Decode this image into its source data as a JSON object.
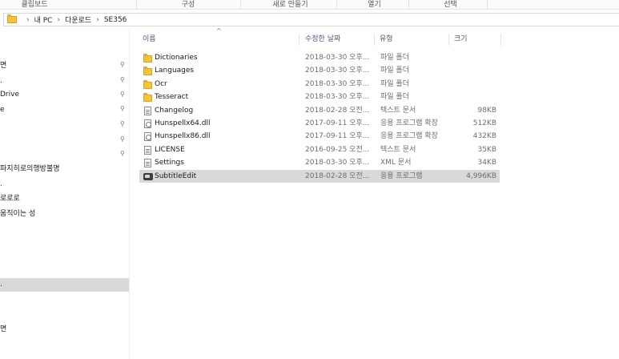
{
  "ribbon": {
    "groups": [
      "클립보드",
      "구성",
      "새로 만들기",
      "열기",
      "선택"
    ]
  },
  "address": {
    "crumbs": [
      "내 PC",
      "다운로드",
      "SE356"
    ],
    "separator": "›"
  },
  "nav": {
    "items": [
      "면",
      ".",
      "Drive",
      "e",
      "",
      "",
      "",
      "파지히로의행방불명",
      ".",
      "로로로",
      "움직이는 성",
      "",
      "",
      "",
      "",
      ".",
      "",
      "",
      "면"
    ],
    "pin_glyph": "⚲"
  },
  "columns": {
    "name": "이름",
    "date": "수정한 날짜",
    "type": "유형",
    "size": "크기",
    "sort_glyph": "^"
  },
  "files": [
    {
      "name": "Dictionaries",
      "date": "2018-03-30 오후...",
      "type": "파일 폴더",
      "size": "",
      "icon": "folder-icon"
    },
    {
      "name": "Languages",
      "date": "2018-03-30 오후...",
      "type": "파일 폴더",
      "size": "",
      "icon": "folder-icon"
    },
    {
      "name": "Ocr",
      "date": "2018-03-30 오후...",
      "type": "파일 폴더",
      "size": "",
      "icon": "folder-icon"
    },
    {
      "name": "Tesseract",
      "date": "2018-03-30 오후...",
      "type": "파일 폴더",
      "size": "",
      "icon": "folder-icon"
    },
    {
      "name": "Changelog",
      "date": "2018-02-28 오전...",
      "type": "텍스트 문서",
      "size": "98KB",
      "icon": "text-file-icon"
    },
    {
      "name": "Hunspellx64.dll",
      "date": "2017-09-11 오후...",
      "type": "응용 프로그램 확장",
      "size": "512KB",
      "icon": "dll-file-icon"
    },
    {
      "name": "Hunspellx86.dll",
      "date": "2017-09-11 오후...",
      "type": "응용 프로그램 확장",
      "size": "432KB",
      "icon": "dll-file-icon"
    },
    {
      "name": "LICENSE",
      "date": "2016-09-25 오전...",
      "type": "텍스트 문서",
      "size": "35KB",
      "icon": "text-file-icon"
    },
    {
      "name": "Settings",
      "date": "2018-03-30 오후...",
      "type": "XML 문서",
      "size": "34KB",
      "icon": "xml-file-icon"
    },
    {
      "name": "SubtitleEdit",
      "date": "2018-02-28 오전...",
      "type": "응용 프로그램",
      "size": "4,996KB",
      "icon": "app-icon"
    }
  ],
  "colors": {
    "selection": "#d9d9d9",
    "header_text": "#4c607a",
    "folder": "#f5c33b"
  }
}
